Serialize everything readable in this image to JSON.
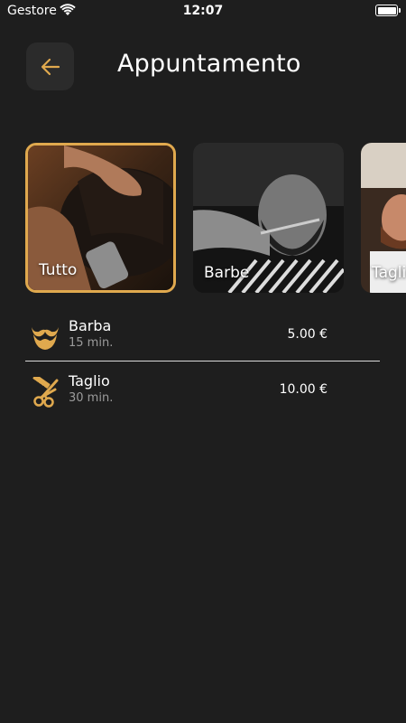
{
  "status_bar": {
    "carrier": "Gestore",
    "time": "12:07"
  },
  "header": {
    "title": "Appuntamento"
  },
  "categories": [
    {
      "label": "Tutto",
      "selected": true
    },
    {
      "label": "Barbe",
      "selected": false
    },
    {
      "label": "Tagli",
      "selected": false
    }
  ],
  "services": [
    {
      "name": "Barba",
      "duration": "15 min.",
      "price": "5.00 €",
      "icon": "mustache-icon"
    },
    {
      "name": "Taglio",
      "duration": "30 min.",
      "price": "10.00 €",
      "icon": "scissors-comb-icon"
    }
  ],
  "colors": {
    "accent": "#e0a94e",
    "background": "#1e1e1e"
  }
}
